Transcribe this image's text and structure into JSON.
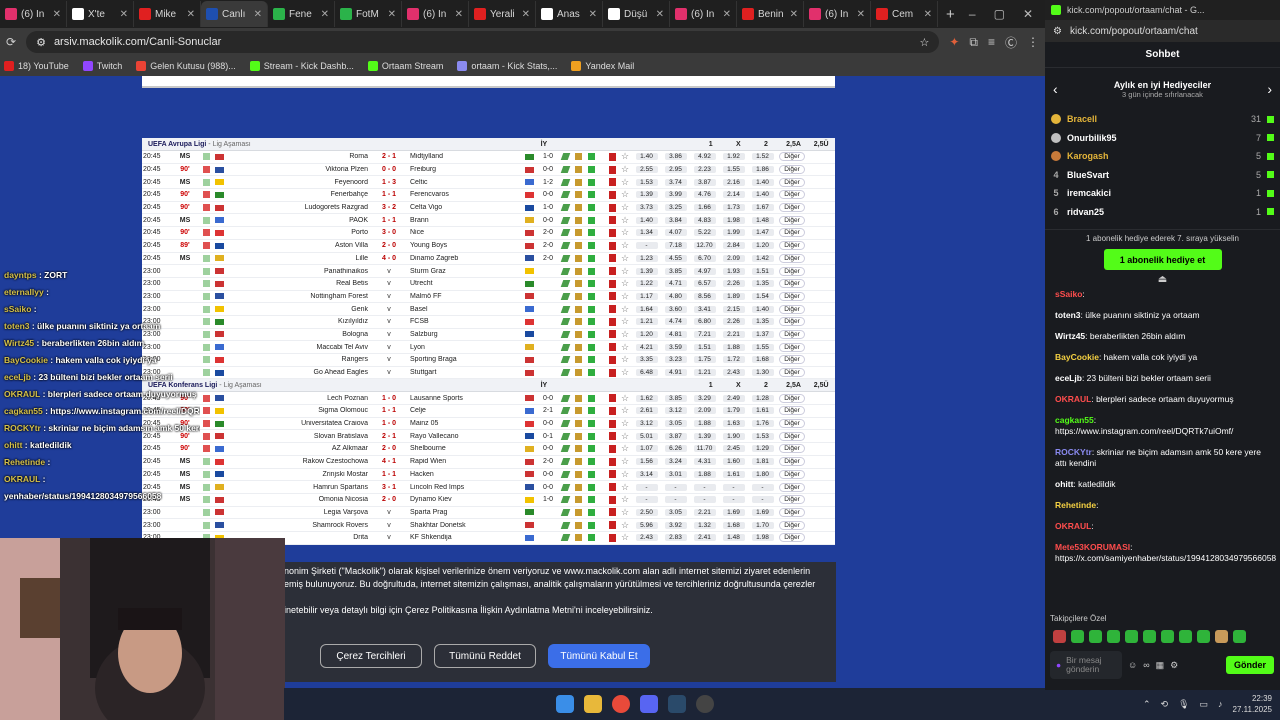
{
  "tabs": [
    {
      "title": "(6) In",
      "color": "#e1306c"
    },
    {
      "title": "X'te",
      "color": "#ffffff"
    },
    {
      "title": "Mike",
      "color": "#e02020"
    },
    {
      "title": "Canlı",
      "color": "#1e4fb0",
      "active": true
    },
    {
      "title": "Fene",
      "color": "#2bb34a"
    },
    {
      "title": "FotM",
      "color": "#2bb34a"
    },
    {
      "title": "(6) In",
      "color": "#e1306c"
    },
    {
      "title": "Yerali",
      "color": "#e02020"
    },
    {
      "title": "Anas",
      "color": "#ffffff"
    },
    {
      "title": "Düşü",
      "color": "#ffffff"
    },
    {
      "title": "(6) In",
      "color": "#e1306c"
    },
    {
      "title": "Benin",
      "color": "#e02020"
    },
    {
      "title": "(6) In",
      "color": "#e1306c"
    },
    {
      "title": "Cem",
      "color": "#e02020"
    }
  ],
  "address": {
    "url": "arsiv.mackolik.com/Canli-Sonuclar"
  },
  "bookmarks": [
    {
      "label": "18) YouTube",
      "color": "#e02020"
    },
    {
      "label": "Twitch",
      "color": "#9146ff"
    },
    {
      "label": "Gelen Kutusu (988)...",
      "color": "#ea4335"
    },
    {
      "label": "Stream - Kick Dashb...",
      "color": "#53fc18"
    },
    {
      "label": "Ortaam Stream",
      "color": "#53fc18"
    },
    {
      "label": "ortaam - Kick Stats,...",
      "color": "#8a8af0"
    },
    {
      "label": "Yandex Mail",
      "color": "#f0a020"
    }
  ],
  "sections": [
    {
      "title": "UEFA Avrupa Ligi",
      "sub": " - Lig Aşaması",
      "iy": "İY",
      "odds_headers": [
        "1",
        "X",
        "2",
        "2,5A",
        "2,5Ü"
      ],
      "rows": [
        [
          "20:45",
          "MS",
          "g",
          "Roma",
          "2 - 1",
          "Midtjylland",
          "1-0",
          [
            "1.40",
            "3.86",
            "4.92",
            "1.92",
            "1.52"
          ]
        ],
        [
          "20:45",
          "90'",
          "r",
          "Viktoria Plzen",
          "0 - 0",
          "Freiburg",
          "0-0",
          [
            "2.55",
            "2.95",
            "2.23",
            "1.55",
            "1.86"
          ]
        ],
        [
          "20:45",
          "MS",
          "g",
          "Feyenoord",
          "1 - 3",
          "Celtic",
          "1-2",
          [
            "1.53",
            "3.74",
            "3.87",
            "2.16",
            "1.40"
          ]
        ],
        [
          "20:45",
          "90'",
          "r",
          "Fenerbahçe",
          "1 - 1",
          "Ferencvaros",
          "0-0",
          [
            "1.39",
            "3.99",
            "4.76",
            "2.14",
            "1.40"
          ]
        ],
        [
          "20:45",
          "90'",
          "r",
          "Ludogorets Razgrad",
          "3 - 2",
          "Celta Vigo",
          "1-0",
          [
            "3.73",
            "3.25",
            "1.66",
            "1.73",
            "1.67"
          ]
        ],
        [
          "20:45",
          "MS",
          "g",
          "PAOK",
          "1 - 1",
          "Brann",
          "0-0",
          [
            "1.40",
            "3.84",
            "4.83",
            "1.98",
            "1.48"
          ]
        ],
        [
          "20:45",
          "90'",
          "r",
          "Porto",
          "3 - 0",
          "Nice",
          "2-0",
          [
            "1.34",
            "4.07",
            "5.22",
            "1.99",
            "1.47"
          ]
        ],
        [
          "20:45",
          "89'",
          "r",
          "Aston Villa",
          "2 - 0",
          "Young Boys",
          "2-0",
          [
            "-",
            "7.18",
            "12.70",
            "2.84",
            "1.20"
          ]
        ],
        [
          "20:45",
          "MS",
          "g",
          "Lille",
          "4 - 0",
          "Dinamo Zagreb",
          "2-0",
          [
            "1.23",
            "4.55",
            "6.70",
            "2.09",
            "1.42"
          ]
        ],
        [
          "23:00",
          "",
          "g",
          "Panathinaikos",
          "v",
          "Sturm Graz",
          "",
          [
            "1.39",
            "3.85",
            "4.97",
            "1.93",
            "1.51"
          ]
        ],
        [
          "23:00",
          "",
          "g",
          "Real Betis",
          "v",
          "Utrecht",
          "",
          [
            "1.22",
            "4.71",
            "6.57",
            "2.26",
            "1.35"
          ]
        ],
        [
          "23:00",
          "",
          "g",
          "Nottingham Forest",
          "v",
          "Malmö FF",
          "",
          [
            "1.17",
            "4.80",
            "8.56",
            "1.89",
            "1.54"
          ]
        ],
        [
          "23:00",
          "",
          "g",
          "Genk",
          "v",
          "Basel",
          "",
          [
            "1.64",
            "3.60",
            "3.41",
            "2.15",
            "1.40"
          ]
        ],
        [
          "23:00",
          "",
          "g",
          "Kızılyıldız",
          "v",
          "FCSB",
          "",
          [
            "1.21",
            "4.74",
            "6.80",
            "2.26",
            "1.35"
          ]
        ],
        [
          "23:00",
          "",
          "g",
          "Bologna",
          "v",
          "Salzburg",
          "",
          [
            "1.20",
            "4.81",
            "7.21",
            "2.21",
            "1.37"
          ]
        ],
        [
          "23:00",
          "",
          "g",
          "Maccabi Tel Aviv",
          "v",
          "Lyon",
          "",
          [
            "4.21",
            "3.59",
            "1.51",
            "1.88",
            "1.55"
          ]
        ],
        [
          "23:00",
          "",
          "g",
          "Rangers",
          "v",
          "Sporting Braga",
          "",
          [
            "3.35",
            "3.23",
            "1.75",
            "1.72",
            "1.68"
          ]
        ],
        [
          "23:00",
          "",
          "g",
          "Go Ahead Eagles",
          "v",
          "Stuttgart",
          "",
          [
            "6.48",
            "4.91",
            "1.21",
            "2.43",
            "1.30"
          ]
        ]
      ]
    },
    {
      "title": "UEFA Konferans Ligi",
      "sub": " - Lig Aşaması",
      "iy": "İY",
      "odds_headers": [
        "1",
        "X",
        "2",
        "2,5A",
        "2,5Ü"
      ],
      "rows": [
        [
          "20:45",
          "90'",
          "r",
          "Lech Poznan",
          "1 - 0",
          "Lausanne Sports",
          "0-0",
          [
            "1.62",
            "3.85",
            "3.29",
            "2.49",
            "1.28"
          ]
        ],
        [
          "20:45",
          "90'",
          "r",
          "Sigma Olomouc",
          "1 - 1",
          "Celje",
          "2-1",
          [
            "2.61",
            "3.12",
            "2.09",
            "1.79",
            "1.61"
          ]
        ],
        [
          "20:45",
          "90'",
          "r",
          "Universitatea Craiova",
          "1 - 0",
          "Mainz 05",
          "0-0",
          [
            "3.12",
            "3.05",
            "1.88",
            "1.63",
            "1.76"
          ]
        ],
        [
          "20:45",
          "90'",
          "r",
          "Slovan Bratislava",
          "2 - 1",
          "Rayo Vallecano",
          "0-1",
          [
            "5.01",
            "3.87",
            "1.39",
            "1.90",
            "1.53"
          ]
        ],
        [
          "20:45",
          "90'",
          "r",
          "AZ Alkmaar",
          "2 - 0",
          "Shelbourne",
          "0-0",
          [
            "1.07",
            "6.26",
            "11.70",
            "2.45",
            "1.29"
          ]
        ],
        [
          "20:45",
          "MS",
          "g",
          "Rakow Czestochowa",
          "4 - 1",
          "Rapid Wien",
          "2-0",
          [
            "1.56",
            "3.24",
            "4.31",
            "1.60",
            "1.81"
          ]
        ],
        [
          "20:45",
          "MS",
          "g",
          "Zrinjski Mostar",
          "1 - 1",
          "Hacken",
          "0-0",
          [
            "3.14",
            "3.01",
            "1.88",
            "1.61",
            "1.80"
          ]
        ],
        [
          "20:45",
          "MS",
          "g",
          "Hamrun Spartans",
          "3 - 1",
          "Lincoln Red Imps",
          "0-0",
          [
            "-",
            "-",
            "-",
            "-",
            "-"
          ]
        ],
        [
          "20:45",
          "MS",
          "g",
          "Omonia Nicosia",
          "2 - 0",
          "Dynamo Kiev",
          "1-0",
          [
            "-",
            "-",
            "-",
            "-",
            "-"
          ]
        ],
        [
          "23:00",
          "",
          "g",
          "Legia Varşova",
          "v",
          "Sparta Prag",
          "",
          [
            "2.50",
            "3.05",
            "2.21",
            "1.69",
            "1.69"
          ]
        ],
        [
          "23:00",
          "",
          "g",
          "Shamrock Rovers",
          "v",
          "Shakhtar Donetsk",
          "",
          [
            "5.96",
            "3.92",
            "1.32",
            "1.68",
            "1.70"
          ]
        ],
        [
          "23:00",
          "",
          "g",
          "Drita",
          "v",
          "KF Shkendija",
          "",
          [
            "2.43",
            "2.83",
            "2.41",
            "1.48",
            "1.98"
          ]
        ]
      ]
    }
  ],
  "cookie": {
    "line1": "nonim Şirketi (\"Mackolik\") olarak kişisel verilerinize önem veriyoruz ve www.mackolik.com alan adlı internet sitemizi ziyaret edenlerin",
    "line2": "emiş bulunuyoruz. Bu doğrultuda, internet sitemizin çalışması, analitik çalışmaların yürütülmesi ve tercihleriniz doğrultusunda çerezler",
    "line3": "inetebilir veya detaylı bilgi için Çerez Politikasına İlişkin Aydınlatma Metni'ni inceleyebilirsiniz.",
    "btn_prefs": "Çerez Tercihleri",
    "btn_reject": "Tümünü Reddet",
    "btn_accept": "Tümünü Kabul Et"
  },
  "overlay_chat": [
    {
      "user": "dayntps",
      "text": " : ZORT"
    },
    {
      "user": "eternallyy",
      "text": " :"
    },
    {
      "user": "sSaiko",
      "text": " :"
    },
    {
      "user": "toten3",
      "text": " : ülke puanını siktiniz ya ortaam"
    },
    {
      "user": "Wirtz45",
      "text": " : beraberlikten 26bin aldım"
    },
    {
      "user": "BayCookie",
      "text": " : hakem valla cok iyiydi ya"
    },
    {
      "user": "eceLjb",
      "text": " : 23 bülteni bizi bekler ortaam serii"
    },
    {
      "user": "OKRAUL",
      "text": " : blerpleri sadece ortaam duyuyormuş"
    },
    {
      "user": "cagkan55",
      "text": " : https://www.instagram.com/reel/DQRTk7uiOmf/"
    },
    {
      "user": "ROCKYtr",
      "text": " : skriniar ne biçim adamsın amk 50 kere yere attı kendini"
    },
    {
      "user": "ohitt",
      "text": " : katledildik"
    },
    {
      "user": "Rehetinde",
      "text": " :"
    },
    {
      "user": "OKRAUL",
      "text": " :"
    },
    {
      "user": "",
      "text": "yenhaber/status/1994128034979566058"
    }
  ],
  "taskbar": {
    "time": "22:39",
    "date": "27.11.2025"
  },
  "kick": {
    "window_title": "kick.com/popout/ortaam/chat - G...",
    "url": "kick.com/popout/ortaam/chat",
    "tab": "Sohbet",
    "lb_title": "Aylık en iyi Hediyeciler",
    "lb_sub": "3 gün içinde sıfırlanacak",
    "leaderboard": [
      {
        "rank": "",
        "name": "Bracell",
        "count": "31",
        "gold": true
      },
      {
        "rank": "",
        "name": "Onurbilik95",
        "count": "7",
        "gold": false
      },
      {
        "rank": "",
        "name": "Karogash",
        "count": "5",
        "gold": true
      },
      {
        "rank": "4",
        "name": "BlueSvart",
        "count": "5",
        "gold": false
      },
      {
        "rank": "5",
        "name": "iremcakici",
        "count": "1",
        "gold": false
      },
      {
        "rank": "6",
        "name": "ridvan25",
        "count": "1",
        "gold": false
      }
    ],
    "sub_info": "1 abonelik hediye ederek 7. sıraya yükselin",
    "sub_btn": "1 abonelik hediye et",
    "messages": [
      {
        "user": "sSaiko",
        "color": "#ff4d4d",
        "text": ":"
      },
      {
        "user": "toten3",
        "color": "#ffffff",
        "text": ": ülke puanını siktiniz ya ortaam"
      },
      {
        "user": "Wirtz45",
        "color": "#ffffff",
        "text": ": beraberlikten 26bin aldım"
      },
      {
        "user": "BayCookie",
        "color": "#f5d142",
        "text": ": hakem valla cok iyiydi ya"
      },
      {
        "user": "eceLjb",
        "color": "#ffffff",
        "text": ": 23 bülteni bizi bekler ortaam serii"
      },
      {
        "user": "OKRAUL",
        "color": "#ff4d4d",
        "text": ": blerpleri sadece ortaam duyuyormuş"
      },
      {
        "user": "cagkan55",
        "color": "#53fc18",
        "text": ": https://www.instagram.com/reel/DQRTk7uiOmf/"
      },
      {
        "user": "ROCKYtr",
        "color": "#8a8af0",
        "text": ": skriniar ne biçim adamsın amk 50 kere yere attı kendini"
      },
      {
        "user": "ohitt",
        "color": "#ffffff",
        "text": ": katledildik"
      },
      {
        "user": "Rehetinde",
        "color": "#f5d142",
        "text": ":"
      },
      {
        "user": "OKRAUL",
        "color": "#ff4d4d",
        "text": ":"
      },
      {
        "user": "Mete53KORUMASI",
        "color": "#ff4d4d",
        "text": ": https://x.com/samiyenhaber/status/1994128034979566058"
      }
    ],
    "takip": "Takipçilere Özel",
    "input_placeholder": "Bir mesaj gönderin",
    "send": "Gönder"
  }
}
